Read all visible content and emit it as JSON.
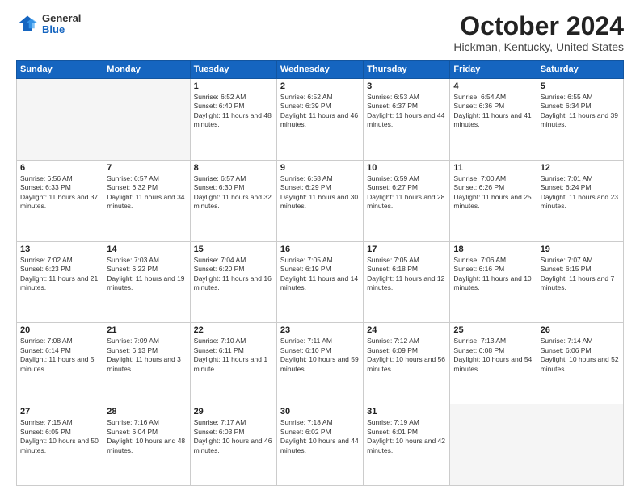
{
  "logo": {
    "general": "General",
    "blue": "Blue"
  },
  "title": "October 2024",
  "location": "Hickman, Kentucky, United States",
  "days_header": [
    "Sunday",
    "Monday",
    "Tuesday",
    "Wednesday",
    "Thursday",
    "Friday",
    "Saturday"
  ],
  "weeks": [
    [
      {
        "day": "",
        "info": ""
      },
      {
        "day": "",
        "info": ""
      },
      {
        "day": "1",
        "info": "Sunrise: 6:52 AM\nSunset: 6:40 PM\nDaylight: 11 hours and 48 minutes."
      },
      {
        "day": "2",
        "info": "Sunrise: 6:52 AM\nSunset: 6:39 PM\nDaylight: 11 hours and 46 minutes."
      },
      {
        "day": "3",
        "info": "Sunrise: 6:53 AM\nSunset: 6:37 PM\nDaylight: 11 hours and 44 minutes."
      },
      {
        "day": "4",
        "info": "Sunrise: 6:54 AM\nSunset: 6:36 PM\nDaylight: 11 hours and 41 minutes."
      },
      {
        "day": "5",
        "info": "Sunrise: 6:55 AM\nSunset: 6:34 PM\nDaylight: 11 hours and 39 minutes."
      }
    ],
    [
      {
        "day": "6",
        "info": "Sunrise: 6:56 AM\nSunset: 6:33 PM\nDaylight: 11 hours and 37 minutes."
      },
      {
        "day": "7",
        "info": "Sunrise: 6:57 AM\nSunset: 6:32 PM\nDaylight: 11 hours and 34 minutes."
      },
      {
        "day": "8",
        "info": "Sunrise: 6:57 AM\nSunset: 6:30 PM\nDaylight: 11 hours and 32 minutes."
      },
      {
        "day": "9",
        "info": "Sunrise: 6:58 AM\nSunset: 6:29 PM\nDaylight: 11 hours and 30 minutes."
      },
      {
        "day": "10",
        "info": "Sunrise: 6:59 AM\nSunset: 6:27 PM\nDaylight: 11 hours and 28 minutes."
      },
      {
        "day": "11",
        "info": "Sunrise: 7:00 AM\nSunset: 6:26 PM\nDaylight: 11 hours and 25 minutes."
      },
      {
        "day": "12",
        "info": "Sunrise: 7:01 AM\nSunset: 6:24 PM\nDaylight: 11 hours and 23 minutes."
      }
    ],
    [
      {
        "day": "13",
        "info": "Sunrise: 7:02 AM\nSunset: 6:23 PM\nDaylight: 11 hours and 21 minutes."
      },
      {
        "day": "14",
        "info": "Sunrise: 7:03 AM\nSunset: 6:22 PM\nDaylight: 11 hours and 19 minutes."
      },
      {
        "day": "15",
        "info": "Sunrise: 7:04 AM\nSunset: 6:20 PM\nDaylight: 11 hours and 16 minutes."
      },
      {
        "day": "16",
        "info": "Sunrise: 7:05 AM\nSunset: 6:19 PM\nDaylight: 11 hours and 14 minutes."
      },
      {
        "day": "17",
        "info": "Sunrise: 7:05 AM\nSunset: 6:18 PM\nDaylight: 11 hours and 12 minutes."
      },
      {
        "day": "18",
        "info": "Sunrise: 7:06 AM\nSunset: 6:16 PM\nDaylight: 11 hours and 10 minutes."
      },
      {
        "day": "19",
        "info": "Sunrise: 7:07 AM\nSunset: 6:15 PM\nDaylight: 11 hours and 7 minutes."
      }
    ],
    [
      {
        "day": "20",
        "info": "Sunrise: 7:08 AM\nSunset: 6:14 PM\nDaylight: 11 hours and 5 minutes."
      },
      {
        "day": "21",
        "info": "Sunrise: 7:09 AM\nSunset: 6:13 PM\nDaylight: 11 hours and 3 minutes."
      },
      {
        "day": "22",
        "info": "Sunrise: 7:10 AM\nSunset: 6:11 PM\nDaylight: 11 hours and 1 minute."
      },
      {
        "day": "23",
        "info": "Sunrise: 7:11 AM\nSunset: 6:10 PM\nDaylight: 10 hours and 59 minutes."
      },
      {
        "day": "24",
        "info": "Sunrise: 7:12 AM\nSunset: 6:09 PM\nDaylight: 10 hours and 56 minutes."
      },
      {
        "day": "25",
        "info": "Sunrise: 7:13 AM\nSunset: 6:08 PM\nDaylight: 10 hours and 54 minutes."
      },
      {
        "day": "26",
        "info": "Sunrise: 7:14 AM\nSunset: 6:06 PM\nDaylight: 10 hours and 52 minutes."
      }
    ],
    [
      {
        "day": "27",
        "info": "Sunrise: 7:15 AM\nSunset: 6:05 PM\nDaylight: 10 hours and 50 minutes."
      },
      {
        "day": "28",
        "info": "Sunrise: 7:16 AM\nSunset: 6:04 PM\nDaylight: 10 hours and 48 minutes."
      },
      {
        "day": "29",
        "info": "Sunrise: 7:17 AM\nSunset: 6:03 PM\nDaylight: 10 hours and 46 minutes."
      },
      {
        "day": "30",
        "info": "Sunrise: 7:18 AM\nSunset: 6:02 PM\nDaylight: 10 hours and 44 minutes."
      },
      {
        "day": "31",
        "info": "Sunrise: 7:19 AM\nSunset: 6:01 PM\nDaylight: 10 hours and 42 minutes."
      },
      {
        "day": "",
        "info": ""
      },
      {
        "day": "",
        "info": ""
      }
    ]
  ]
}
